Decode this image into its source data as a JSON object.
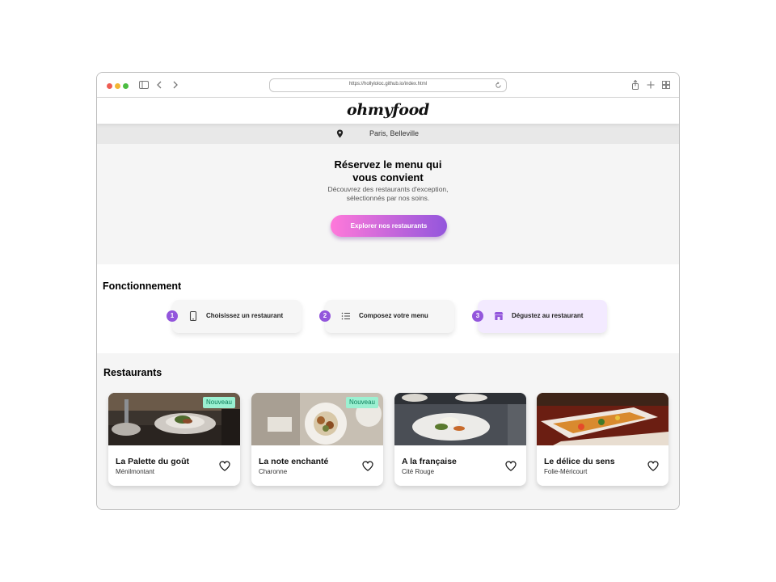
{
  "browser": {
    "url": "https://hollyloloc.github.io/index.html",
    "icons": [
      "sidebar-icon",
      "back-icon",
      "forward-icon",
      "reload-icon",
      "share-icon",
      "new-tab-icon",
      "tabs-overview-icon"
    ]
  },
  "site": {
    "logo": "ohmyfood",
    "location": "Paris, Belleville"
  },
  "hero": {
    "title_line1": "Réservez le menu qui",
    "title_line2": "vous convient",
    "subtitle_line1": "Découvrez des restaurants d'exception,",
    "subtitle_line2": "sélectionnés par nos soins.",
    "cta": "Explorer nos restaurants"
  },
  "how": {
    "title": "Fonctionnement",
    "steps": [
      {
        "number": "1",
        "label": "Choisissez un restaurant",
        "icon": "mobile-phone-icon"
      },
      {
        "number": "2",
        "label": "Composez votre menu",
        "icon": "list-icon"
      },
      {
        "number": "3",
        "label": "Dégustez au restaurant",
        "icon": "store-icon"
      }
    ]
  },
  "restaurants": {
    "title": "Restaurants",
    "items": [
      {
        "name": "La Palette du goût",
        "area": "Ménilmontant",
        "badge": "Nouveau"
      },
      {
        "name": "La note enchanté",
        "area": "Charonne",
        "badge": "Nouveau"
      },
      {
        "name": "A la française",
        "area": "Cité Rouge",
        "badge": ""
      },
      {
        "name": "Le délice du sens",
        "area": "Folie-Méricourt",
        "badge": ""
      }
    ]
  },
  "colors": {
    "accent_purple": "#9356dc",
    "accent_pink": "#ff79da",
    "badge_bg": "#9bf0d1",
    "badge_text": "#0b7f5a"
  }
}
